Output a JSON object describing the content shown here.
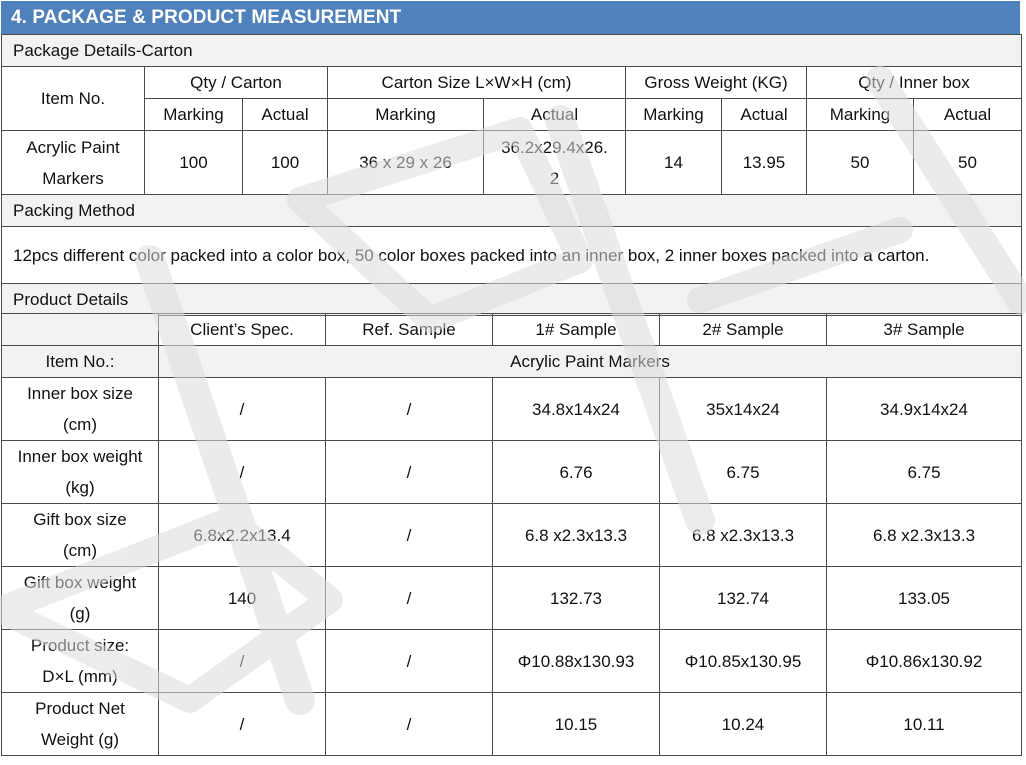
{
  "section_title": "4. PACKAGE & PRODUCT MEASUREMENT",
  "package": {
    "subtitle": "Package Details-Carton",
    "headers": {
      "item_no": "Item No.",
      "qty_carton": "Qty / Carton",
      "carton_size": "Carton Size L×W×H (cm)",
      "gross_weight": "Gross Weight (KG)",
      "qty_inner": "Qty / Inner box",
      "marking": "Marking",
      "actual": "Actual"
    },
    "row": {
      "item": "Acrylic Paint Markers",
      "qty_marking": "100",
      "qty_actual": "100",
      "size_marking": "36 x 29 x 26",
      "size_actual": "36.2x29.4x26.2",
      "weight_marking": "14",
      "weight_actual": "13.95",
      "inner_marking": "50",
      "inner_actual": "50"
    },
    "packing_method_title": "Packing Method",
    "packing_method_text": "12pcs different color packed into a color box, 50 color boxes packed into an inner box, 2 inner boxes packed into a carton."
  },
  "product": {
    "subtitle": "Product Details",
    "columns": [
      "",
      "Client’s Spec.",
      "Ref. Sample",
      "1# Sample",
      "2# Sample",
      "3# Sample"
    ],
    "item_no_label": "Item No.:",
    "item_no_value": "Acrylic Paint Markers",
    "rows": [
      {
        "label": "Inner box size (cm)",
        "values": [
          "/",
          "/",
          "34.8x14x24",
          "35x14x24",
          "34.9x14x24"
        ]
      },
      {
        "label": "Inner box weight (kg)",
        "values": [
          "/",
          "/",
          "6.76",
          "6.75",
          "6.75"
        ]
      },
      {
        "label": "Gift box size (cm)",
        "values": [
          "6.8x2.2x13.4",
          "/",
          "6.8 x2.3x13.3",
          "6.8 x2.3x13.3",
          "6.8 x2.3x13.3"
        ]
      },
      {
        "label": "Gift box weight (g)",
        "values": [
          "140",
          "/",
          "132.73",
          "132.74",
          "133.05"
        ]
      },
      {
        "label": "Product size: D×L (mm)",
        "values": [
          "/",
          "/",
          "Φ10.88x130.93",
          "Φ10.85x130.95",
          "Φ10.86x130.92"
        ]
      },
      {
        "label": "Product Net Weight (g)",
        "values": [
          "/",
          "/",
          "10.15",
          "10.24",
          "10.11"
        ]
      }
    ]
  },
  "watermark": {
    "color": "#dcdcdc"
  }
}
